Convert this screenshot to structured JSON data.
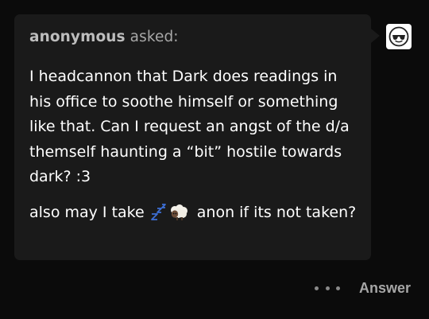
{
  "ask": {
    "asker": "anonymous",
    "asked_label": "asked:",
    "question_text": "I headcannon that Dark does readings in his office to soothe himself or something like that. Can I request an angst of the d/a themself haunting a “bit” hostile towards dark? :3",
    "followup_before": "also may I take",
    "followup_after": "anon if its not taken?",
    "followup_emojis": [
      "zzz-emoji",
      "sheep-emoji"
    ]
  },
  "avatar": {
    "icon": "sunglasses-face-avatar-icon"
  },
  "footer": {
    "more_icon": "more-dots-icon",
    "answer_label": "Answer"
  },
  "colors": {
    "page_bg": "#0b0b0b",
    "bubble_bg": "#1a1a1a",
    "text": "#ffffff",
    "muted": "#a6a6a6"
  }
}
